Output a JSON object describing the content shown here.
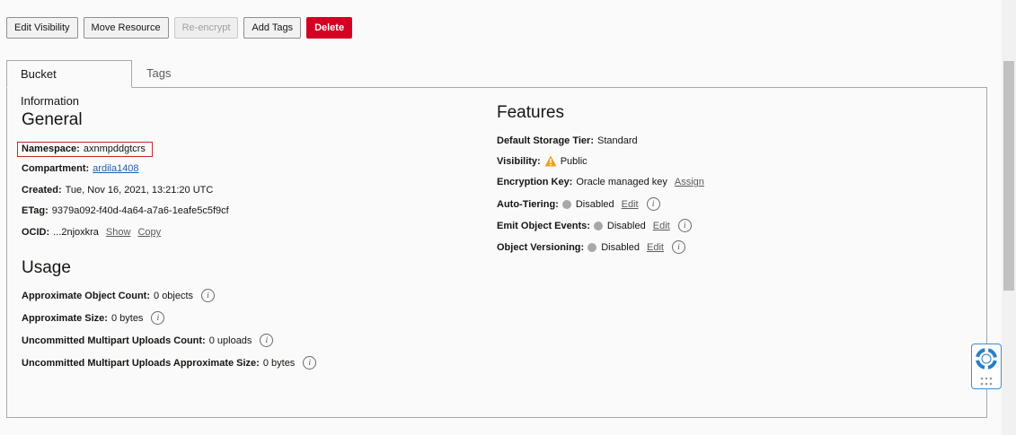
{
  "toolbar": {
    "edit_visibility": "Edit Visibility",
    "move_resource": "Move Resource",
    "re_encrypt": "Re-encrypt",
    "add_tags": "Add Tags",
    "delete": "Delete"
  },
  "tabs": {
    "bucket_information": "Bucket Information",
    "tags": "Tags"
  },
  "general": {
    "heading": "General",
    "namespace_label": "Namespace:",
    "namespace_value": "axnmpddgtcrs",
    "compartment_label": "Compartment:",
    "compartment_value": "ardila1408",
    "created_label": "Created:",
    "created_value": "Tue, Nov 16, 2021, 13:21:20 UTC",
    "etag_label": "ETag:",
    "etag_value": "9379a092-f40d-4a64-a7a6-1eafe5c5f9cf",
    "ocid_label": "OCID:",
    "ocid_value": "...2njoxkra",
    "show": "Show",
    "copy": "Copy"
  },
  "usage": {
    "heading": "Usage",
    "object_count_label": "Approximate Object Count:",
    "object_count_value": "0 objects",
    "size_label": "Approximate Size:",
    "size_value": "0 bytes",
    "multipart_count_label": "Uncommitted Multipart Uploads Count:",
    "multipart_count_value": "0 uploads",
    "multipart_size_label": "Uncommitted Multipart Uploads Approximate Size:",
    "multipart_size_value": "0 bytes"
  },
  "features": {
    "heading": "Features",
    "storage_tier_label": "Default Storage Tier:",
    "storage_tier_value": "Standard",
    "visibility_label": "Visibility:",
    "visibility_value": "Public",
    "encryption_label": "Encryption Key:",
    "encryption_value": "Oracle managed key",
    "assign": "Assign",
    "auto_tiering_label": "Auto-Tiering:",
    "auto_tiering_value": "Disabled",
    "emit_events_label": "Emit Object Events:",
    "emit_events_value": "Disabled",
    "versioning_label": "Object Versioning:",
    "versioning_value": "Disabled",
    "edit": "Edit"
  },
  "icons": {
    "info": "info-icon",
    "warning": "warning-icon",
    "status_dot": "status-dot",
    "help": "lifebuoy-icon"
  },
  "colors": {
    "delete_button": "#d30023",
    "link": "#1f5fb0",
    "warning": "#f0a020",
    "disabled_dot": "#a8a8a8",
    "highlight_box": "#c22a2a",
    "help_accent": "#2a7fc4"
  }
}
